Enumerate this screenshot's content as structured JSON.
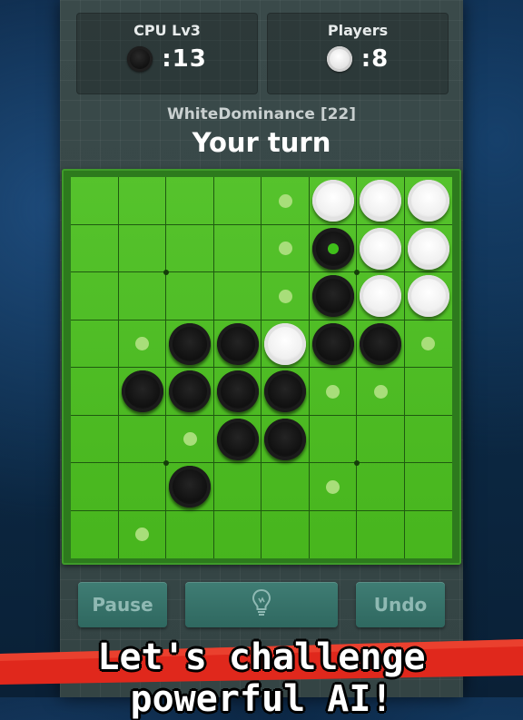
{
  "cpu": {
    "name": "CPU Lv3",
    "score": ":13",
    "disc_color": "black"
  },
  "players": {
    "name": "Players",
    "score": ":8",
    "disc_color": "white"
  },
  "opponent_strategy": "WhiteDominance [22]",
  "turn_text": "Your turn",
  "board": {
    "size": 8,
    "rows": [
      ". . . . h W W W",
      ". . . . h B W W",
      ". . . . h B W W",
      ". h B B W B B h",
      ". B B B B h h .",
      ". . h B B . . .",
      ". . B . . h . .",
      ". h . . . . . ."
    ],
    "legend": {
      "B": "black disc",
      "W": "white disc",
      "h": "possible move hint",
      ".": "empty"
    },
    "last_move": {
      "row": 1,
      "col": 5
    }
  },
  "buttons": {
    "pause": "Pause",
    "hint_icon": "lightbulb-icon",
    "undo": "Undo"
  },
  "banner": "Let's challenge powerful AI!",
  "colors": {
    "board_green": "#4bbf1f",
    "grid_line": "#1f5a10",
    "button_teal": "#3f7d74",
    "banner_red": "#e0281c"
  }
}
